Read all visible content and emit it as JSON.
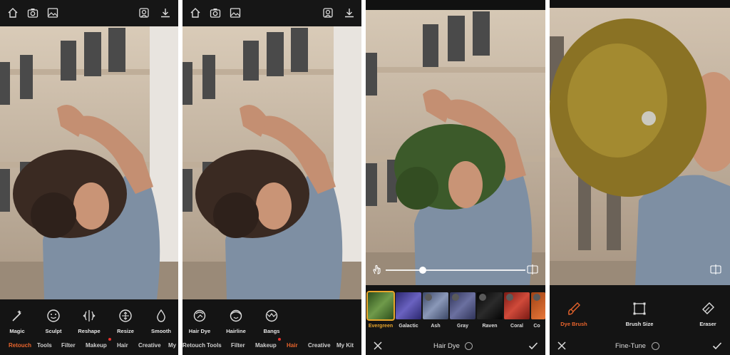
{
  "panel1": {
    "tools": [
      "Magic",
      "Sculpt",
      "Reshape",
      "Resize",
      "Smooth"
    ],
    "tabs": [
      "Retouch",
      "Tools",
      "Filter",
      "Makeup",
      "Hair",
      "Creative",
      "My"
    ],
    "active_tab": "Retouch"
  },
  "panel2": {
    "tools": [
      "Hair Dye",
      "Hairline",
      "Bangs"
    ],
    "tabs": [
      "Retouch",
      "Tools",
      "Filter",
      "Makeup",
      "Hair",
      "Creative",
      "My Kit"
    ],
    "active_tab": "Hair"
  },
  "panel3": {
    "swatches": [
      {
        "label": "Evergreen",
        "color": "#3f6a2a"
      },
      {
        "label": "Galactic",
        "color": "#3f3a8a"
      },
      {
        "label": "Ash",
        "color": "#5d6b8a"
      },
      {
        "label": "Gray",
        "color": "#4a4f7e"
      },
      {
        "label": "Raven",
        "color": "#141414"
      },
      {
        "label": "Coral",
        "color": "#b3322a"
      },
      {
        "label": "Co",
        "color": "#d2642a"
      }
    ],
    "footer_title": "Hair Dye"
  },
  "panel4": {
    "tools": [
      "Dye Brush",
      "Brush Size",
      "Eraser"
    ],
    "active_tool": "Dye Brush",
    "footer_title": "Fine-Tune"
  },
  "colors": {
    "accent": "#e8642c",
    "selected_swatch": "#e8a52c",
    "notify_dot": "#e8322c"
  }
}
